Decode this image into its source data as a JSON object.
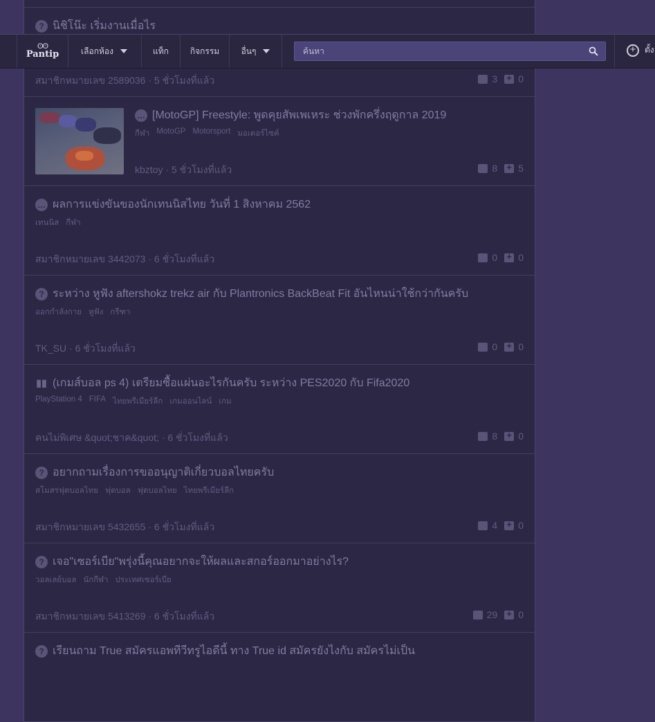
{
  "nav": {
    "logo_text": "Pantip",
    "menu_select_room": "เลือกห้อง",
    "menu_tag": "แท็ก",
    "menu_activity": "กิจกรรม",
    "menu_more": "อื่นๆ",
    "search_placeholder": "ค้นหา",
    "new_topic_label": "ตั้ง"
  },
  "topics": [
    {
      "title": "",
      "tags": [],
      "author": "",
      "time": "",
      "comments": "",
      "votes": ""
    },
    {
      "title": "นิชิโน๊ะ เริ่มงานเมื่อไร",
      "icon": "question-icon",
      "tags": [],
      "author": "สมาชิกหมายเลข 2589036",
      "time": "5 ชั่วโมงที่แล้ว",
      "comments": "3",
      "votes": "0"
    },
    {
      "title": "[MotoGP] Freestyle: พูดคุยสัพเพเหระ ช่วงพักครึ่งฤดูกาล 2019",
      "icon": "chat-icon",
      "tags": [
        "กีฬา",
        "MotoGP",
        "Motorsport",
        "มอเตอร์ไซค์"
      ],
      "author": "kbztoy",
      "time": "5 ชั่วโมงที่แล้ว",
      "comments": "8",
      "votes": "5",
      "thumb": true
    },
    {
      "title": "ผลการแข่งขันของนักเทนนิสไทย วันที่ 1 สิงหาคม 2562",
      "icon": "chat-icon",
      "tags": [
        "เทนนิส",
        "กีฬา"
      ],
      "author": "สมาชิกหมายเลข 3442073",
      "time": "6 ชั่วโมงที่แล้ว",
      "comments": "0",
      "votes": "0"
    },
    {
      "title": "ระหว่าง หูฟัง aftershokz trekz air กับ Plantronics BackBeat Fit อันไหนน่าใช้กว่ากันครับ",
      "icon": "question-icon",
      "tags": [
        "ออกกำลังกาย",
        "หูฟัง",
        "กรีฑา"
      ],
      "author": "TK_SU",
      "time": "6 ชั่วโมงที่แล้ว",
      "comments": "0",
      "votes": "0"
    },
    {
      "title": "(เกมส์บอล ps 4) เตรียมซื้อแผ่นอะไรกันครับ ระหว่าง PES2020 กับ Fifa2020",
      "icon": "poll-icon",
      "tags": [
        "PlayStation 4",
        "FIFA",
        "ไทยพรีเมียร์ลีก",
        "เกมออนไลน์",
        "เกม"
      ],
      "author": "คนไม่พิเศษ &quot;ชาค&quot;",
      "time": "6 ชั่วโมงที่แล้ว",
      "comments": "8",
      "votes": "0"
    },
    {
      "title": "อยากถามเรื่องการขออนุญาติเกี่ยวบอลไทยครับ",
      "icon": "question-icon",
      "tags": [
        "สโมสรฟุตบอลไทย",
        "ฟุตบอล",
        "ฟุตบอลไทย",
        "ไทยพรีเมียร์ลีก"
      ],
      "author": "สมาชิกหมายเลข 5432655",
      "time": "6 ชั่วโมงที่แล้ว",
      "comments": "4",
      "votes": "0"
    },
    {
      "title": "เจอ\"เซอร์เบีย\"พรุ่งนี้คุณอยากจะให้ผลและสกอร์ออกมาอย่างไร?",
      "icon": "question-icon",
      "tags": [
        "วอลเลย์บอล",
        "นักกีฬา",
        "ประเทศเซอร์เบีย"
      ],
      "author": "สมาชิกหมายเลข 5413269",
      "time": "6 ชั่วโมงที่แล้ว",
      "comments": "29",
      "votes": "0"
    },
    {
      "title": "เรียนถาม True สมัครแอพทีวีทรูไอดีนี้ ทาง True id สมัครยังไงกับ สมัครไม่เป็น",
      "icon": "question-icon",
      "tags": [],
      "author": "",
      "time": "",
      "comments": "",
      "votes": ""
    }
  ]
}
